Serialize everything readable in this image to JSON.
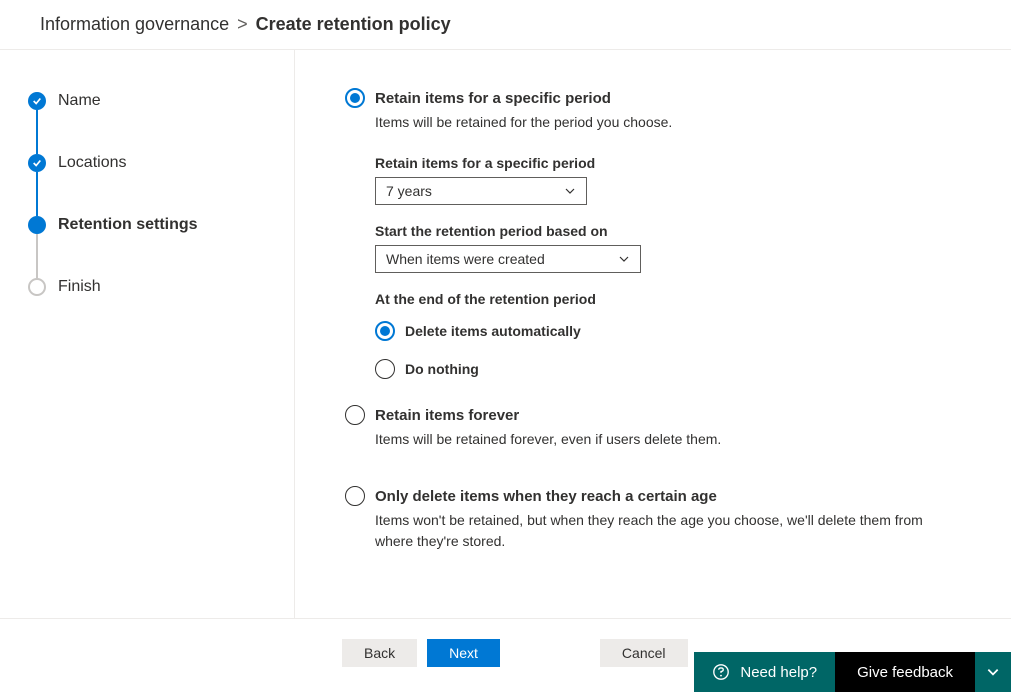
{
  "breadcrumb": {
    "parent": "Information governance",
    "separator": ">",
    "current": "Create retention policy"
  },
  "steps": [
    {
      "label": "Name",
      "state": "done"
    },
    {
      "label": "Locations",
      "state": "done"
    },
    {
      "label": "Retention settings",
      "state": "current"
    },
    {
      "label": "Finish",
      "state": "pending"
    }
  ],
  "options": {
    "specific": {
      "title": "Retain items for a specific period",
      "desc": "Items will be retained for the period you choose.",
      "selected": true,
      "fields": {
        "period_label": "Retain items for a specific period",
        "period_value": "7 years",
        "start_label": "Start the retention period based on",
        "start_value": "When items were created",
        "end_label": "At the end of the retention period",
        "end_options": {
          "delete": "Delete items automatically",
          "nothing": "Do nothing"
        },
        "end_selected": "delete"
      }
    },
    "forever": {
      "title": "Retain items forever",
      "desc": "Items will be retained forever, even if users delete them.",
      "selected": false
    },
    "delete_only": {
      "title": "Only delete items when they reach a certain age",
      "desc": "Items won't be retained, but when they reach the age you choose, we'll delete them from where they're stored.",
      "selected": false
    }
  },
  "footer": {
    "back": "Back",
    "next": "Next",
    "cancel": "Cancel"
  },
  "help_bar": {
    "help": "Need help?",
    "feedback": "Give feedback"
  }
}
